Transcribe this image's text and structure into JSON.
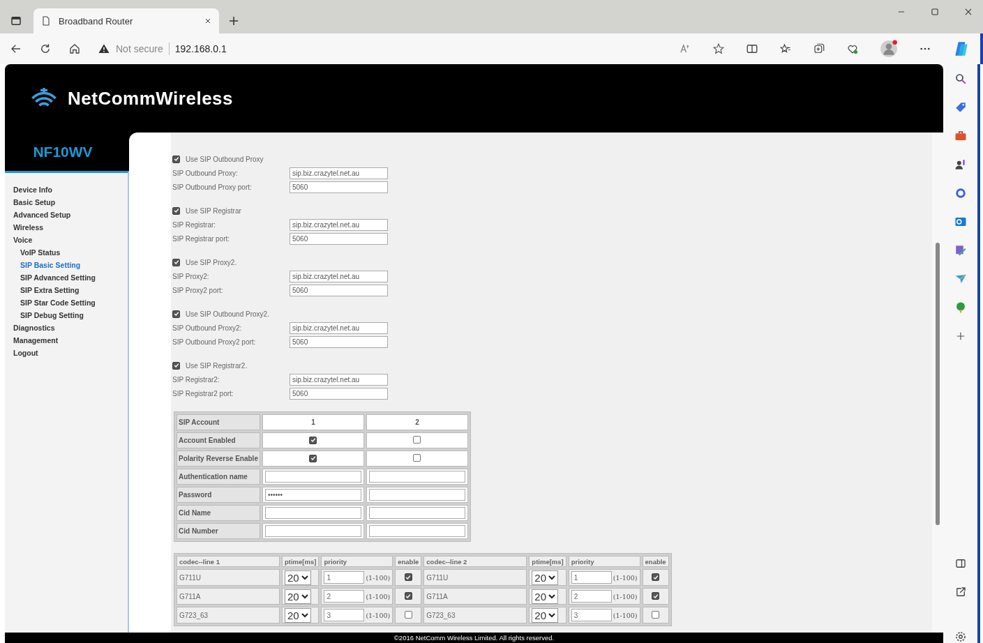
{
  "browser": {
    "tab_title": "Broadband Router",
    "security": "Not secure",
    "url": "192.168.0.1"
  },
  "brand": {
    "logo": "NetCommWireless",
    "model": "NF10WV"
  },
  "nav": [
    {
      "label": "Device Info",
      "selected": false
    },
    {
      "label": "Basic Setup",
      "selected": false
    },
    {
      "label": "Advanced Setup",
      "selected": false
    },
    {
      "label": "Wireless",
      "selected": false
    },
    {
      "label": "Voice",
      "selected": false,
      "children": [
        {
          "label": "VoIP Status",
          "selected": false
        },
        {
          "label": "SIP Basic Setting",
          "selected": true
        },
        {
          "label": "SIP Advanced Setting",
          "selected": false
        },
        {
          "label": "SIP Extra Setting",
          "selected": false
        },
        {
          "label": "SIP Star Code Setting",
          "selected": false
        },
        {
          "label": "SIP Debug Setting",
          "selected": false
        }
      ]
    },
    {
      "label": "Diagnostics",
      "selected": false
    },
    {
      "label": "Management",
      "selected": false
    },
    {
      "label": "Logout",
      "selected": false
    }
  ],
  "server_groups": [
    {
      "checkbox_label": "Use SIP Outbound Proxy",
      "checked": true,
      "fields": [
        {
          "label": "SIP Outbound Proxy:",
          "value": "sip.biz.crazytel.net.au"
        },
        {
          "label": "SIP Outbound Proxy port:",
          "value": "5060"
        }
      ]
    },
    {
      "checkbox_label": "Use SIP Registrar",
      "checked": true,
      "fields": [
        {
          "label": "SIP Registrar:",
          "value": "sip.biz.crazytel.net.au"
        },
        {
          "label": "SIP Registrar port:",
          "value": "5060"
        }
      ]
    },
    {
      "checkbox_label": "Use SIP Proxy2.",
      "checked": true,
      "fields": [
        {
          "label": "SIP Proxy2:",
          "value": "sip.biz.crazytel.net.au"
        },
        {
          "label": "SIP Proxy2 port:",
          "value": "5060"
        }
      ]
    },
    {
      "checkbox_label": "Use SIP Outbound Proxy2.",
      "checked": true,
      "fields": [
        {
          "label": "SIP Outbound Proxy2:",
          "value": "sip.biz.crazytel.net.au"
        },
        {
          "label": "SIP Outbound Proxy2 port:",
          "value": "5060"
        }
      ]
    },
    {
      "checkbox_label": "Use SIP Registrar2.",
      "checked": true,
      "fields": [
        {
          "label": "SIP Registrar2:",
          "value": "sip.biz.crazytel.net.au"
        },
        {
          "label": "SIP Registrar2 port:",
          "value": "5060"
        }
      ]
    }
  ],
  "account_table": {
    "header": [
      "SIP Account",
      "1",
      "2"
    ],
    "rows": [
      {
        "label": "Account Enabled",
        "kind": "checkbox",
        "cells": [
          {
            "checked": true
          },
          {
            "checked": false
          }
        ]
      },
      {
        "label": "Polarity Reverse Enable",
        "kind": "checkbox",
        "cells": [
          {
            "checked": true
          },
          {
            "checked": false
          }
        ]
      },
      {
        "label": "Authentication name",
        "kind": "text",
        "cells": [
          {},
          {}
        ]
      },
      {
        "label": "Password",
        "kind": "text",
        "cells": [
          {
            "value": "••••••"
          },
          {}
        ]
      },
      {
        "label": "Cid Name",
        "kind": "text",
        "cells": [
          {},
          {}
        ]
      },
      {
        "label": "Cid Number",
        "kind": "text",
        "cells": [
          {},
          {}
        ]
      }
    ]
  },
  "codec_table": {
    "columns": [
      "codec--line 1",
      "ptime[ms]",
      "priority",
      "enable",
      "codec--line 2",
      "ptime[ms]",
      "priority",
      "enable"
    ],
    "rows": [
      {
        "lines": [
          {
            "codec": "G711U",
            "ptime": "20",
            "priority": "1",
            "range": "(1-100)",
            "enable": true
          },
          {
            "codec": "G711U",
            "ptime": "20",
            "priority": "1",
            "range": "(1-100)",
            "enable": true
          }
        ]
      },
      {
        "lines": [
          {
            "codec": "G711A",
            "ptime": "20",
            "priority": "2",
            "range": "(1-100)",
            "enable": true
          },
          {
            "codec": "G711A",
            "ptime": "20",
            "priority": "2",
            "range": "(1-100)",
            "enable": true
          }
        ]
      },
      {
        "lines": [
          {
            "codec": "G723_63",
            "ptime": "20",
            "priority": "3",
            "range": "(1-100)",
            "enable": false
          },
          {
            "codec": "G723_63",
            "ptime": "20",
            "priority": "3",
            "range": "(1-100)",
            "enable": false
          }
        ]
      }
    ]
  },
  "footer": "©2016 NetComm Wireless Limited. All rights reserved."
}
